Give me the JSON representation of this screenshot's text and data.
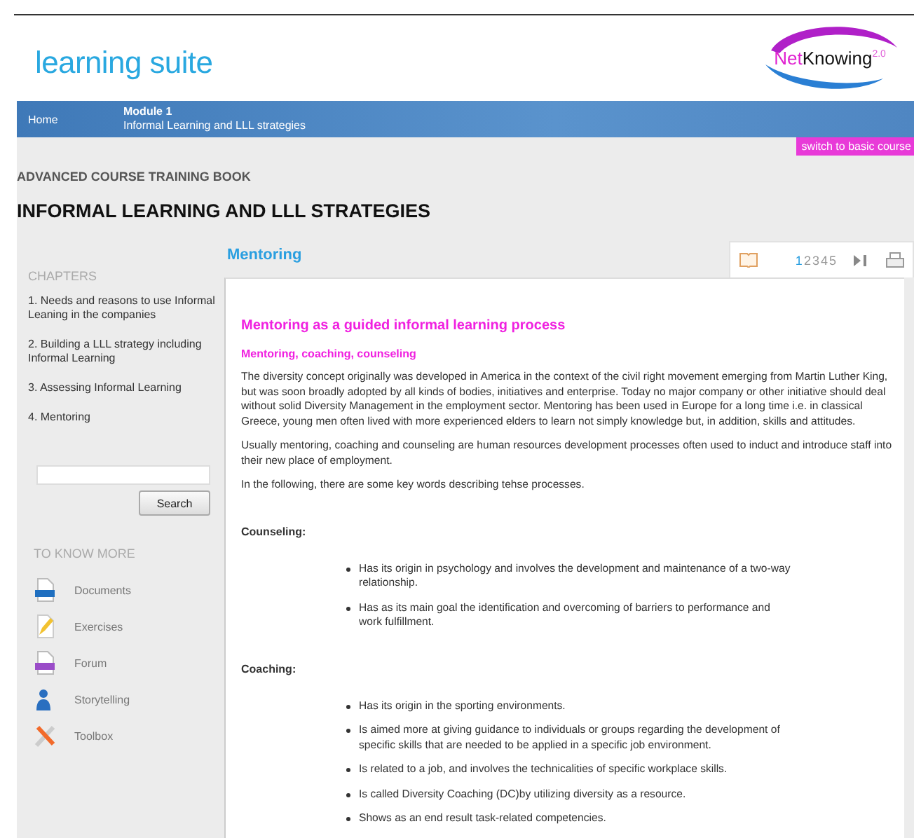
{
  "header": {
    "logo": "learning suite",
    "brand_prefix": "Net",
    "brand_name": "Knowing",
    "brand_version": "2.0"
  },
  "nav": {
    "home": "Home",
    "module_title": "Module 1",
    "module_subtitle": "Informal Learning and LLL strategies"
  },
  "switch_button": "switch to basic course",
  "book_label": "ADVANCED COURSE TRAINING BOOK",
  "book_title": "INFORMAL LEARNING AND LLL STRATEGIES",
  "sidebar": {
    "chapters_heading": "CHAPTERS",
    "chapters": [
      {
        "label": "1. Needs and reasons to use Informal Leaning in the companies"
      },
      {
        "label": "2. Building a LLL strategy including Informal Learning"
      },
      {
        "label": "3. Assessing Informal Learning"
      },
      {
        "label": "4. Mentoring"
      }
    ],
    "search_button": "Search",
    "more_heading": "TO KNOW MORE",
    "resources": [
      {
        "label": "Documents",
        "kind": "doc"
      },
      {
        "label": "Exercises",
        "kind": "pencil"
      },
      {
        "label": "Forum",
        "kind": "forum"
      },
      {
        "label": "Storytelling",
        "kind": "person"
      },
      {
        "label": "Toolbox",
        "kind": "tools"
      }
    ]
  },
  "content": {
    "section_title": "Mentoring",
    "pages": [
      {
        "label": "1",
        "selected": true
      },
      {
        "label": "2",
        "selected": false
      },
      {
        "label": "3",
        "selected": false
      },
      {
        "label": "4",
        "selected": false
      },
      {
        "label": "5",
        "selected": false
      }
    ],
    "heading": "Mentoring as a guided informal learning process",
    "subheading": "Mentoring, coaching, counseling",
    "paragraphs": [
      "The diversity concept originally was developed in America in the context of the civil right movement emerging from Martin Luther King, but was soon broadly adopted by all kinds of bodies, initiatives and enterprise. Today no major company or other initiative should deal without solid Diversity Management in the employment sector. Mentoring has been used in Europe for a long time i.e. in classical Greece, young men often lived with more experienced elders to learn not simply knowledge but, in addition, skills and attitudes.",
      "Usually mentoring, coaching and counseling are human resources development processes often used to induct and introduce staff into their new place of employment.",
      "In the following, there are some key words describing tehse processes."
    ],
    "sections": [
      {
        "title": "Counseling:",
        "bullets": [
          "Has its origin in psychology and involves the development and maintenance of a two-way relationship.",
          "Has as its main goal the identification and overcoming of barriers to performance and work fulfillment."
        ]
      },
      {
        "title": "Coaching:",
        "bullets": [
          "Has its origin in the sporting environments.",
          "Is aimed more at giving guidance to individuals or groups regarding the development of specific skills that are needed to be applied in a specific job environment.",
          "Is related to a job, and involves the technicalities of specific workplace skills.",
          "Is called Diversity Coaching (DC)by utilizing diversity as a resource.",
          "Shows as an end result task-related competencies."
        ]
      }
    ]
  }
}
